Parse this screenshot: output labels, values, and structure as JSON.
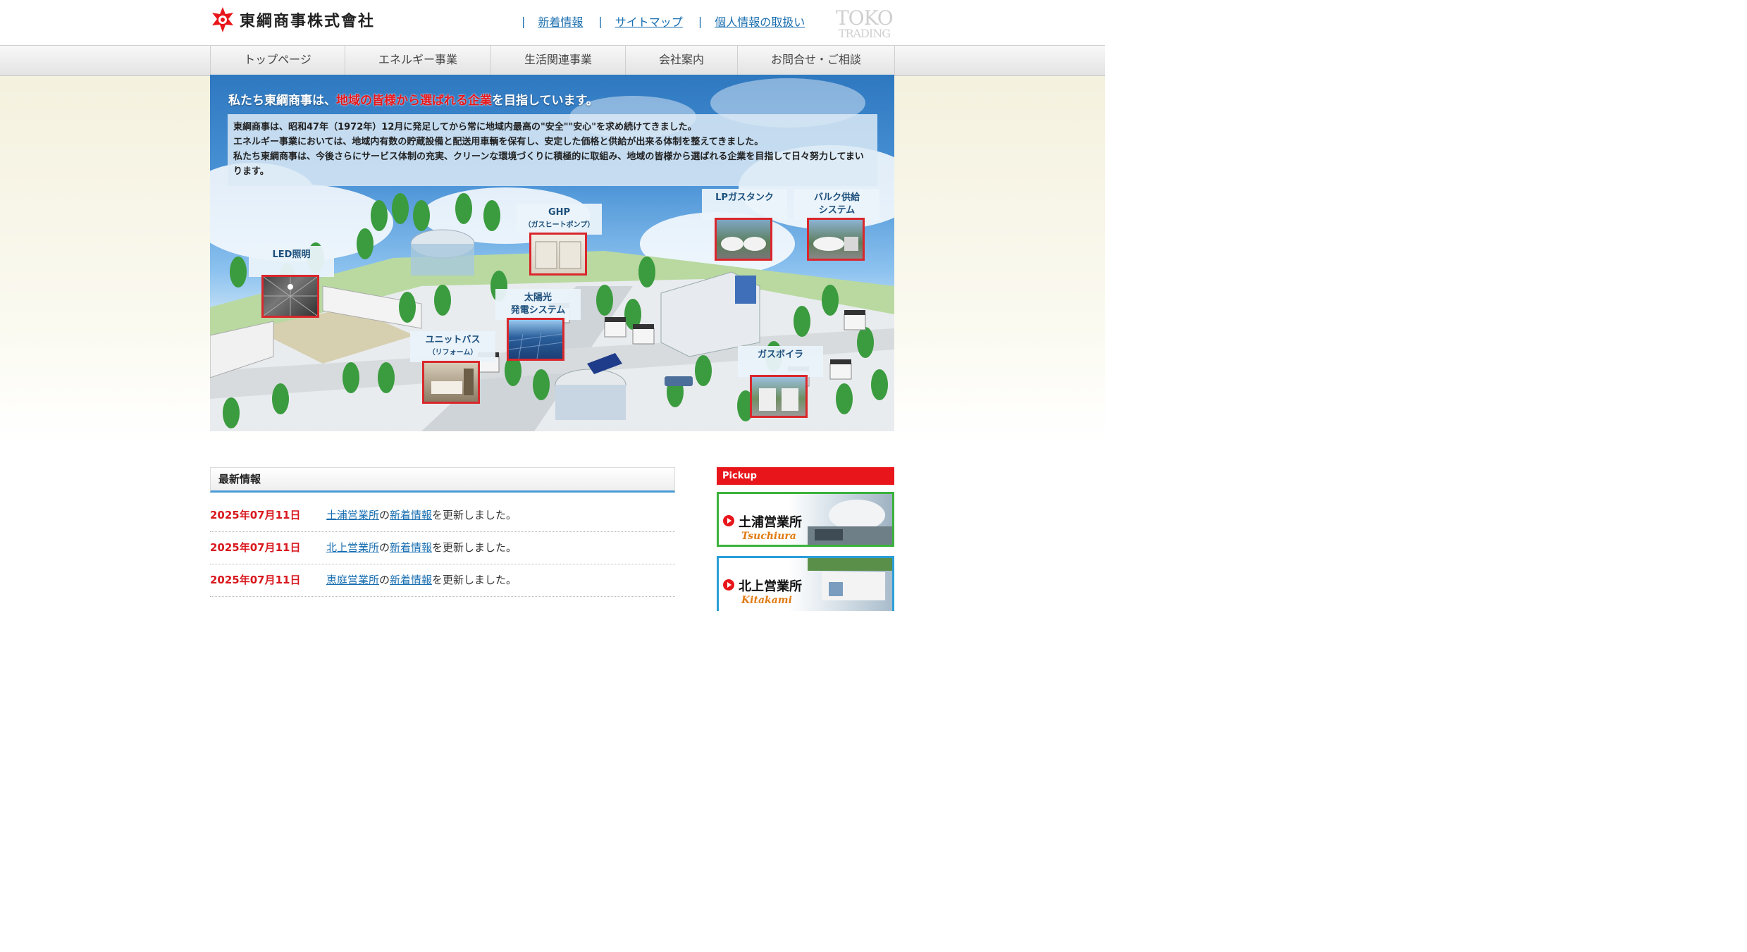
{
  "header": {
    "company_name": "東綱商事株式會社",
    "utility_links": [
      "新着情報",
      "サイトマップ",
      "個人情報の取扱い"
    ],
    "separator": "|",
    "brand_mark": [
      "TOKO",
      "TRADING"
    ]
  },
  "global_nav": {
    "items": [
      "トップページ",
      "エネルギー事業",
      "生活関連事業",
      "会社案内",
      "お問合せ・ご相談"
    ]
  },
  "hero": {
    "headline_before": "私たち東綱商事は、",
    "headline_highlight": "地域の皆様から選ばれる企業",
    "headline_after": "を目指しています。",
    "intro_lines": [
      "東綱商事は、昭和47年（1972年）12月に発足してから常に地域内最高の\"安全\"\"安心\"を求め続けてきました。",
      "エネルギー事業においては、地域内有数の貯蔵設備と配送用車輌を保有し、安定した価格と供給が出来る体制を整えてきました。",
      "私たち東綱商事は、今後さらにサービス体制の充実、クリーンな環境づくりに積極的に取組み、地域の皆様から選ばれる企業を目指して日々努力してまいります。"
    ],
    "labels": {
      "led": "LED照明",
      "ghp": "GHP",
      "ghp_sub": "（ガスヒートポンプ）",
      "lp_tank": "LPガスタンク",
      "bulk_1": "バルク供給",
      "bulk_2": "システム",
      "solar_1": "太陽光",
      "solar_2": "発電システム",
      "unit_bath": "ユニットバス",
      "unit_bath_sub": "（リフォーム）",
      "gas_boiler": "ガスボイラ"
    }
  },
  "news": {
    "heading": "最新情報",
    "items": [
      {
        "date": "2025年07月11日",
        "office": "土浦営業所",
        "particle": "の",
        "link": "新着情報",
        "suffix": "を更新しました。"
      },
      {
        "date": "2025年07月11日",
        "office": "北上営業所",
        "particle": "の",
        "link": "新着情報",
        "suffix": "を更新しました。"
      },
      {
        "date": "2025年07月11日",
        "office": "恵庭営業所",
        "particle": "の",
        "link": "新着情報",
        "suffix": "を更新しました。"
      }
    ]
  },
  "pickup": {
    "heading": "Pickup",
    "banners": [
      {
        "title": "土浦営業所",
        "sub": "Tsuchiura",
        "border": "#3bb23b"
      },
      {
        "title": "北上営業所",
        "sub": "Kitakami",
        "border": "#2a9fd8"
      }
    ]
  },
  "colors": {
    "accent_red": "#e8161b",
    "link_blue": "#1a6fb0",
    "date_red": "#d9181e"
  }
}
